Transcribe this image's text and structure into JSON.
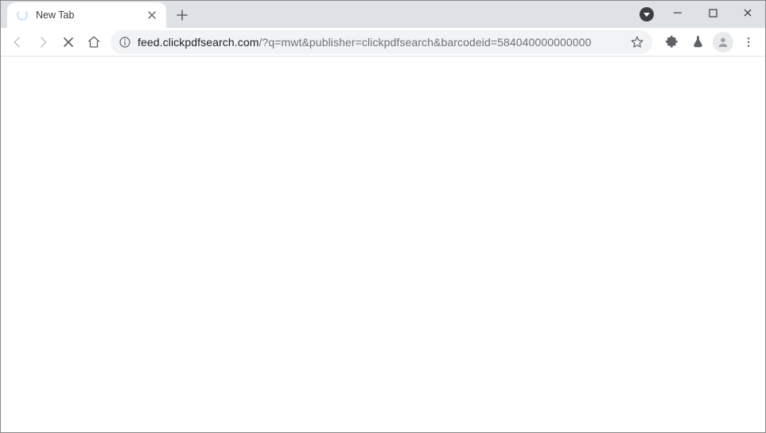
{
  "tab": {
    "title": "New Tab"
  },
  "address": {
    "host": "feed.clickpdfsearch.com",
    "path": "/?q=mwt&publisher=clickpdfsearch&barcodeid=584040000000000"
  }
}
